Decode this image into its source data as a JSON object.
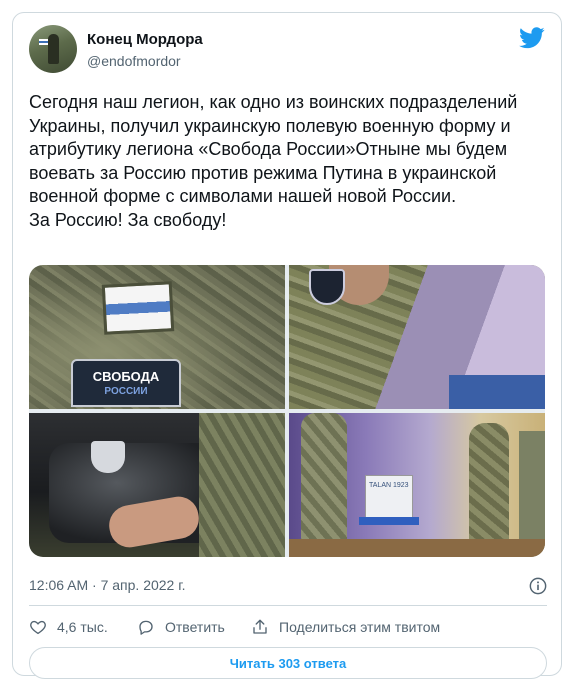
{
  "author": {
    "name": "Конец Мордора",
    "handle": "@endofmordor"
  },
  "tweet": {
    "text": "Сегодня наш легион, как одно из воинских подразделений Украины, получил украинскую полевую военную форму и атрибутику легиона «Свобода России»Отныне мы будем воевать за Россию против режима Путина в украинской военной форме с символами нашей новой России.\nЗа Россию! За свободу!",
    "timestamp": "12:06 AM · 7 апр. 2022 г."
  },
  "media": {
    "photo1_badge_line1": "СВОБОДА",
    "photo1_badge_line2": "РОССИИ",
    "photo4_box_text": "TALAN 1923"
  },
  "actions": {
    "likes": "4,6 тыс.",
    "reply_label": "Ответить",
    "share_label": "Поделиться этим твитом"
  },
  "read_replies_label": "Читать 303 ответа",
  "colors": {
    "accent": "#1d9bf0",
    "secondary_text": "#536471",
    "border": "#cfd9de"
  },
  "icons": {
    "logo": "twitter-bird-icon",
    "info": "info-icon",
    "like": "heart-icon",
    "reply": "reply-bubble-icon",
    "share": "share-upload-icon"
  }
}
